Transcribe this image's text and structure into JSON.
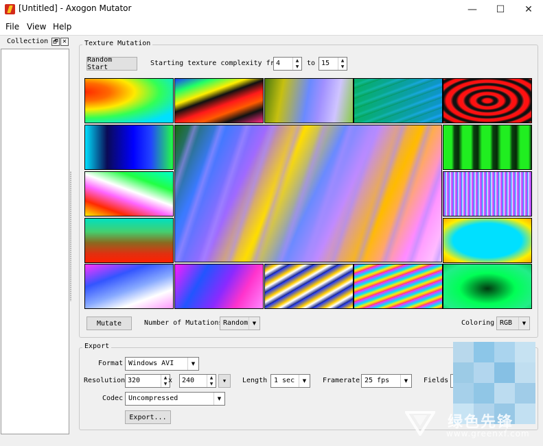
{
  "window": {
    "title": "[Untitled] - Axogon Mutator",
    "min_glyph": "—",
    "max_glyph": "☐",
    "close_glyph": "✕"
  },
  "menu": [
    "File",
    "View",
    "Help"
  ],
  "collection": {
    "title": "Collection",
    "float_glyph": "🗗",
    "close_glyph": "✕"
  },
  "texture_mutation": {
    "title": "Texture Mutation",
    "random_start_label": "Random Start",
    "complexity_label": "Starting texture complexity from",
    "complexity_from": "4",
    "to_label": "to",
    "complexity_to": "15",
    "mutate_label": "Mutate",
    "num_mutations_label": "Number of Mutations",
    "num_mutations_value": "Random",
    "coloring_label": "Coloring",
    "coloring_value": "RGB"
  },
  "export": {
    "title": "Export",
    "format_label": "Format",
    "format_value": "Windows AVI",
    "resolution_label": "Resolution",
    "res_width": "320",
    "x_label": "x",
    "res_height": "240",
    "length_label": "Length",
    "length_value": "1 sec",
    "framerate_label": "Framerate",
    "framerate_value": "25 fps",
    "fields_label": "Fields",
    "codec_label": "Codec",
    "codec_value": "Uncompressed",
    "export_button_label": "Export..."
  },
  "watermark": {
    "text": "绿色先锋",
    "url": "www.greenxf.com"
  },
  "colors": {
    "accent_red": "#d32a1a",
    "panel_bg": "#f0f0f0",
    "pixel_blocks": [
      "#b8d8ec",
      "#8cc6e8",
      "#aad4ee",
      "#c6e2f2",
      "#9ccbe6",
      "#b2d6ee",
      "#86c0e4",
      "#c0def0",
      "#a6d0ea",
      "#90c6e6",
      "#bcdcf0",
      "#a0cce8",
      "#c8e4f4",
      "#b0d4ec",
      "#98c8e6",
      "#c2e0f2"
    ]
  }
}
